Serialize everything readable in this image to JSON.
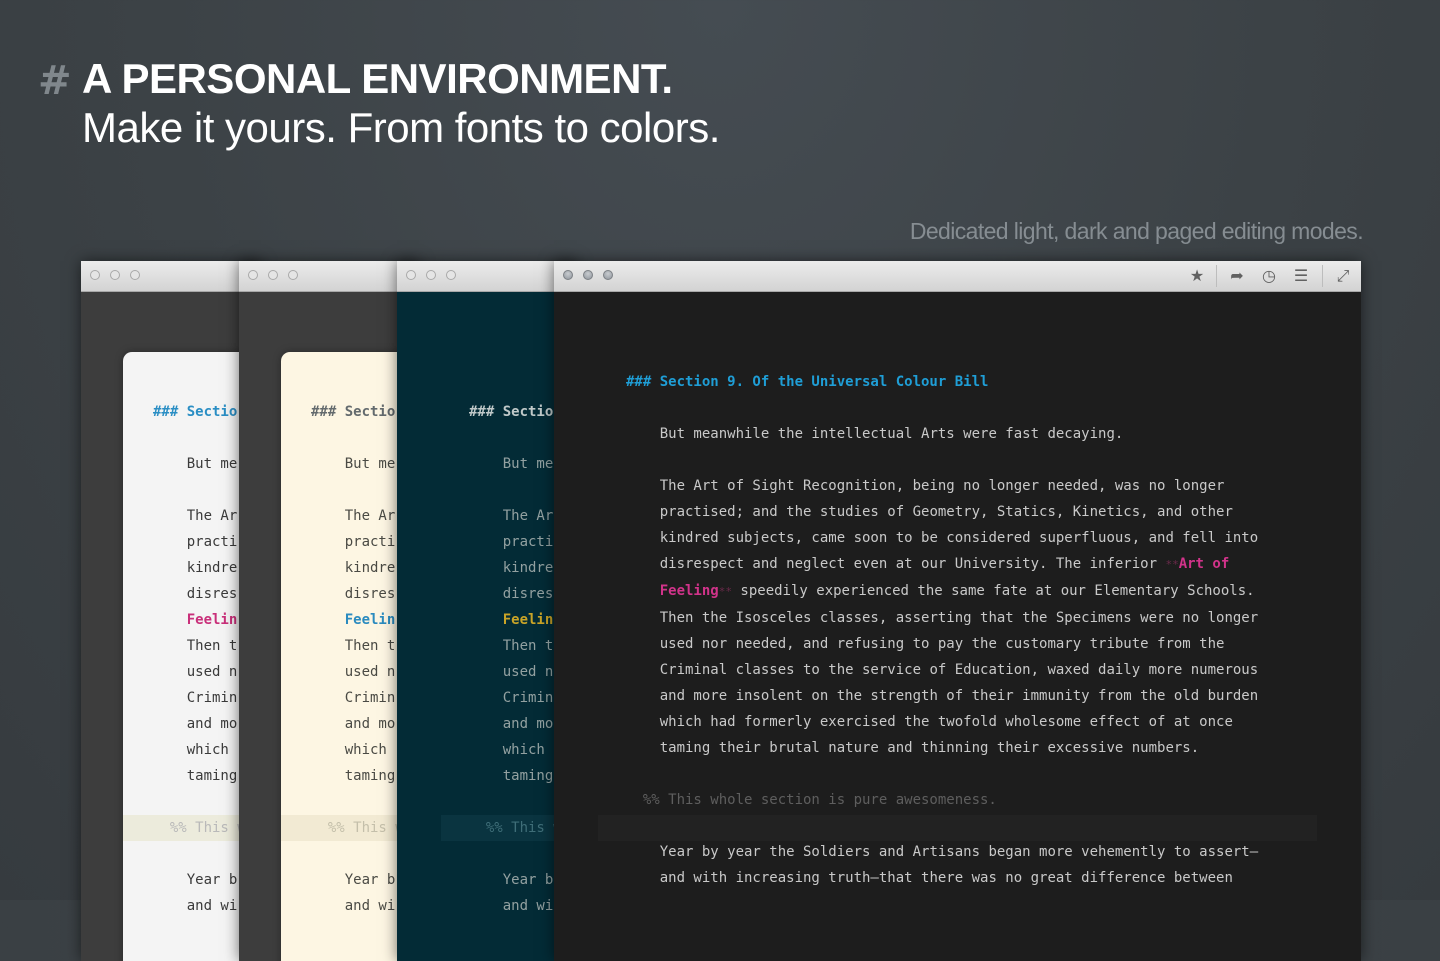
{
  "hero": {
    "hash": "#",
    "title": "A PERSONAL ENVIRONMENT.",
    "subtitle": "Make it yours. From fonts to colors.",
    "caption": "Dedicated light, dark and paged editing modes."
  },
  "windows": [
    {
      "mode": "paged light",
      "heading": "### Sectio",
      "lines": [
        "But me",
        "",
        "The Ar",
        "practi",
        "kindre",
        "disres"
      ],
      "emph": "Feelin",
      "lines2": [
        "Then t",
        "used n",
        "Crimin",
        "and mo",
        "which ",
        "taming"
      ],
      "comment": "%% This w",
      "tail": [
        "Year b",
        "and wi"
      ],
      "colors": {
        "bg": "#3d3d3d",
        "paper": "#f4f4f4",
        "text": "#3a3a3a",
        "heading": "#2a8ec4",
        "emph": "#c9307a",
        "comment": "#b9b9b9",
        "band": "#ecebdc"
      }
    },
    {
      "mode": "paged sepia",
      "heading": "### Sectio",
      "lines": [
        "But me",
        "",
        "The Ar",
        "practi",
        "kindre",
        "disres"
      ],
      "emph": "Feelin",
      "lines2": [
        "Then t",
        "used n",
        "Crimin",
        "and mo",
        "which ",
        "taming"
      ],
      "comment": "%% This w",
      "tail": [
        "Year b",
        "and wi"
      ],
      "colors": {
        "bg": "#3d3d3d",
        "paper": "#fdf6e3",
        "text": "#4a4a44",
        "heading": "#636a6d",
        "emph": "#2b8bbf",
        "comment": "#c4bfaa",
        "band": "#f2ead3"
      }
    },
    {
      "mode": "dark solarized",
      "heading": "### Sectio",
      "lines": [
        "But me",
        "",
        "The Ar",
        "practi",
        "kindre",
        "disres"
      ],
      "emph": "Feelin",
      "lines2": [
        "Then t",
        "used n",
        "Crimin",
        "and mo",
        "which ",
        "taming"
      ],
      "comment": "%% This w",
      "tail": [
        "Year b",
        "and wi"
      ],
      "colors": {
        "bg": "#032b36",
        "text": "#93a1a1",
        "heading": "#c0c9c9",
        "emph": "#c9a427",
        "comment": "#3f6e78",
        "band": "#0a3440"
      }
    },
    {
      "mode": "dark",
      "heading": "### Section 9. Of the Universal Colour Bill",
      "lines": [
        "But meanwhile the intellectual Arts were fast decaying.",
        "",
        "The Art of Sight Recognition, being no longer needed, was no longer",
        "practised; and the studies of Geometry, Statics, Kinetics, and other",
        "kindred subjects, came soon to be considered superfluous, and fell into"
      ],
      "line_pre": "disrespect and neglect even at our University. The inferior ",
      "emph_a": "Art of",
      "emph_b": "Feeling",
      "line_post": " speedily experienced the same fate at our Elementary Schools.",
      "lines2": [
        "Then the Isosceles classes, asserting that the Specimens were no longer",
        "used nor needed, and refusing to pay the customary tribute from the",
        "Criminal classes to the service of Education, waxed daily more numerous",
        "and more insolent on the strength of their immunity from the old burden",
        "which had formerly exercised the twofold wholesome effect of at once",
        "taming their brutal nature and thinning their excessive numbers."
      ],
      "comment": "%% This whole section is pure awesomeness.",
      "tail": [
        "Year by year the Soldiers and Artisans began more vehemently to assert—",
        "and with increasing truth—that there was no great difference between"
      ],
      "colors": {
        "bg": "#1d1d1d",
        "text": "#c9c9c9",
        "heading": "#1f9ed6",
        "emph": "#d1338a",
        "marker": "#6a2a4a",
        "comment": "#5e5e5e",
        "band": "#222222"
      }
    }
  ],
  "toolbar": {
    "star_icon": "★",
    "share_icon": "➦",
    "history_icon": "◷",
    "list_icon": "☰",
    "fullscreen_icon": "⤢"
  }
}
